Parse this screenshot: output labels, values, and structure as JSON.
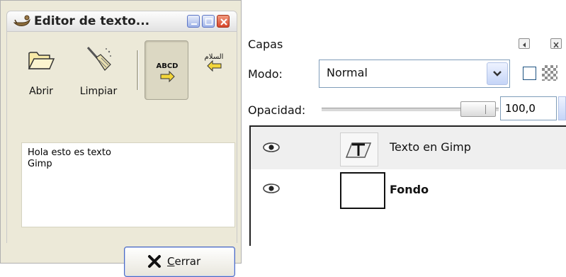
{
  "editor": {
    "title": "Editor de texto...",
    "toolbar": {
      "open_label": "Abrir",
      "clear_label": "Limpiar",
      "ltr_text": "ABCD",
      "rtl_text": "السلام"
    },
    "text_content": "Hola esto es texto\nGimp",
    "close_prefix": "C",
    "close_rest": "errar"
  },
  "layers": {
    "title": "Capas",
    "mode_label": "Modo:",
    "mode_value": "Normal",
    "opacity_label": "Opacidad:",
    "opacity_value": "100,0",
    "opacity_percent": 100,
    "items": [
      {
        "name": "Texto en Gimp",
        "visible": true,
        "type": "text"
      },
      {
        "name": "Fondo",
        "visible": true,
        "type": "image"
      }
    ]
  },
  "colors": {
    "window_bg": "#ece9d8",
    "close_red": "#d6452a",
    "xp_blue": "#4b69c3"
  },
  "icons": [
    "gimp-logo-icon",
    "minimize-icon",
    "maximize-icon",
    "close-icon",
    "folder-open-icon",
    "broom-icon",
    "ltr-text-icon",
    "rtl-text-icon",
    "x-icon",
    "dock-arrow-icon",
    "chevron-down-icon",
    "eye-icon",
    "text-layer-icon"
  ]
}
